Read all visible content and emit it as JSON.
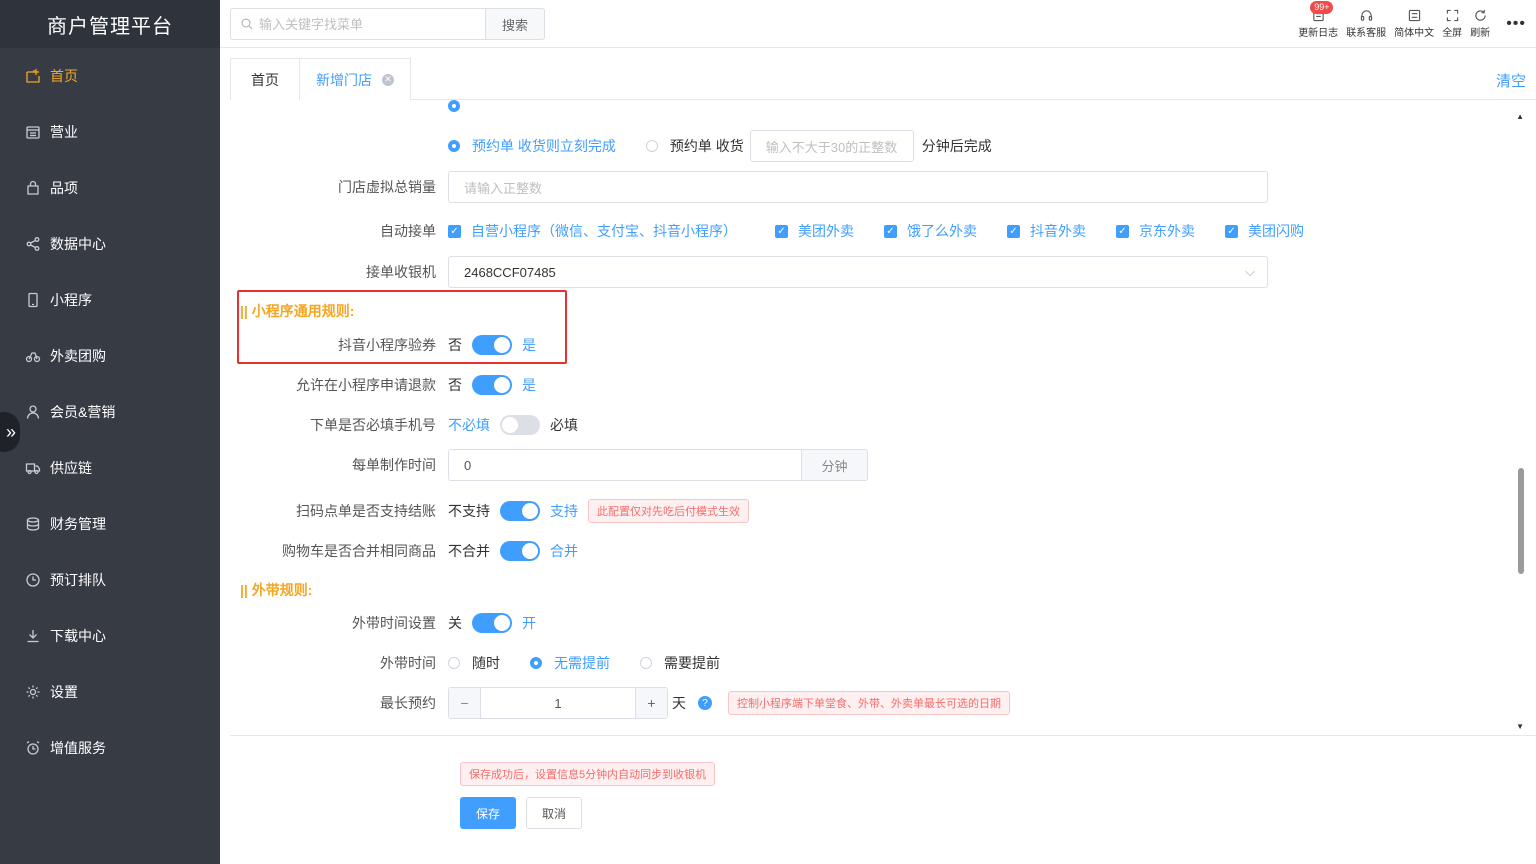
{
  "app": {
    "title": "商户管理平台"
  },
  "sidebar": {
    "items": [
      {
        "label": "首页",
        "icon": "home-icon",
        "active": true
      },
      {
        "label": "营业",
        "icon": "calendar-icon"
      },
      {
        "label": "品项",
        "icon": "bag-icon"
      },
      {
        "label": "数据中心",
        "icon": "share-icon"
      },
      {
        "label": "小程序",
        "icon": "phone-icon"
      },
      {
        "label": "外卖团购",
        "icon": "bike-icon"
      },
      {
        "label": "会员&营销",
        "icon": "user-icon"
      },
      {
        "label": "供应链",
        "icon": "truck-icon"
      },
      {
        "label": "财务管理",
        "icon": "database-icon"
      },
      {
        "label": "预订排队",
        "icon": "clock-icon"
      },
      {
        "label": "下载中心",
        "icon": "download-icon"
      },
      {
        "label": "设置",
        "icon": "gear-icon"
      },
      {
        "label": "增值服务",
        "icon": "alarm-icon"
      }
    ]
  },
  "header": {
    "search_placeholder": "输入关键字找菜单",
    "search_button": "搜索",
    "tools": {
      "changelog": "更新日志",
      "changelog_badge": "99+",
      "support": "联系客服",
      "language": "简体中文",
      "fullscreen": "全屏",
      "refresh": "刷新",
      "more": "•••"
    }
  },
  "tabs": {
    "home": "首页",
    "new_store": "新增门店",
    "clear": "清空"
  },
  "form": {
    "reservation": {
      "option_a": "预约单 收货则立刻完成",
      "option_b": "预约单 收货",
      "input_placeholder": "输入不大于30的正整数",
      "suffix": "分钟后完成"
    },
    "virtual_sales": {
      "label": "门店虚拟总销量",
      "placeholder": "请输入正整数"
    },
    "auto_accept": {
      "label": "自动接单",
      "options": [
        "自营小程序（微信、支付宝、抖音小程序）",
        "美团外卖",
        "饿了么外卖",
        "抖音外卖",
        "京东外卖",
        "美团闪购"
      ]
    },
    "cashier": {
      "label": "接单收银机",
      "value": "2468CCF07485"
    },
    "miniapp_section": "|| 小程序通用规则:",
    "douyin_coupon": {
      "label": "抖音小程序验券",
      "off": "否",
      "on": "是"
    },
    "refund": {
      "label": "允许在小程序申请退款",
      "off": "否",
      "on": "是"
    },
    "phone_required": {
      "label": "下单是否必填手机号",
      "off": "不必填",
      "on": "必填"
    },
    "make_time": {
      "label": "每单制作时间",
      "value": "0",
      "unit": "分钟"
    },
    "scan_checkout": {
      "label": "扫码点单是否支持结账",
      "off": "不支持",
      "on": "支持",
      "tip": "此配置仅对先吃后付模式生效"
    },
    "merge_cart": {
      "label": "购物车是否合并相同商品",
      "off": "不合并",
      "on": "合并"
    },
    "takeout_section": "|| 外带规则:",
    "takeout_time_setting": {
      "label": "外带时间设置",
      "off": "关",
      "on": "开"
    },
    "takeout_time": {
      "label": "外带时间",
      "options": [
        "随时",
        "无需提前",
        "需要提前"
      ]
    },
    "max_reserve": {
      "label": "最长预约",
      "minus": "−",
      "value": "1",
      "plus": "+",
      "unit": "天",
      "help": "?",
      "tip": "控制小程序端下单堂食、外带、外卖单最长可选的日期"
    }
  },
  "footer": {
    "tip": "保存成功后，设置信息5分钟内自动同步到收银机",
    "save": "保存",
    "cancel": "取消"
  },
  "colors": {
    "accent": "#409eff",
    "sidebar_bg": "#363b44",
    "active": "#f5a623",
    "highlight_box": "#e8312f"
  }
}
